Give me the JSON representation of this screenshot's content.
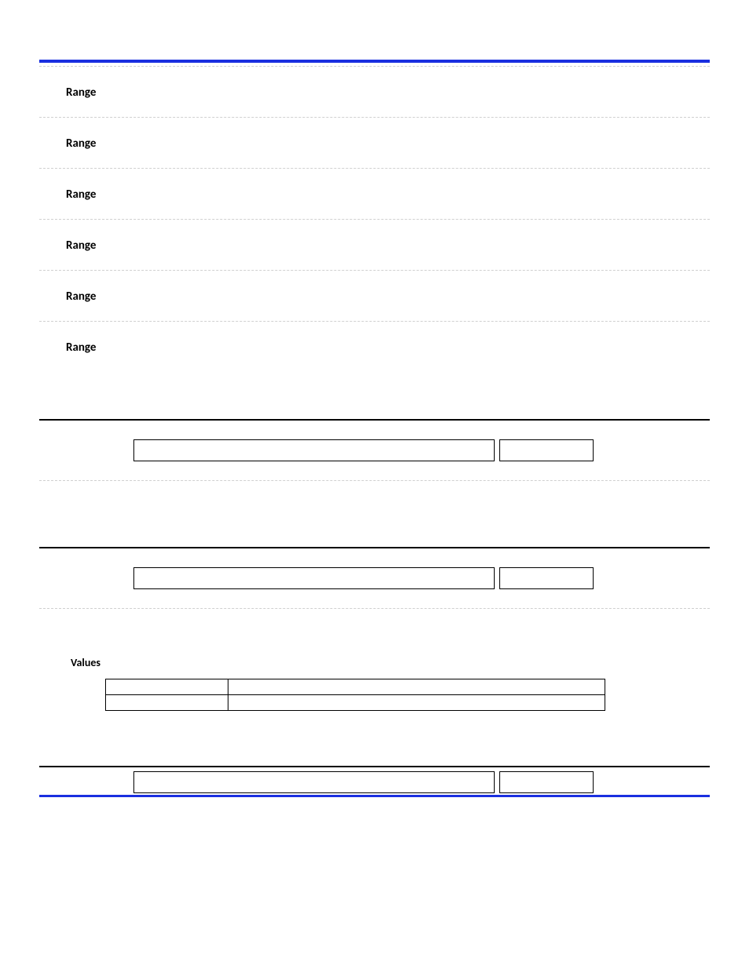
{
  "ranges": [
    {
      "label": "Range"
    },
    {
      "label": "Range"
    },
    {
      "label": "Range"
    },
    {
      "label": "Range"
    },
    {
      "label": "Range"
    },
    {
      "label": "Range"
    }
  ],
  "section1": {
    "box1": "",
    "box2": ""
  },
  "section2": {
    "box1": "",
    "box2": "",
    "values_heading": "Values",
    "table_rows": [
      {
        "c1": "",
        "c2": ""
      },
      {
        "c1": "",
        "c2": ""
      }
    ]
  },
  "section3": {
    "box1": "",
    "box2": ""
  }
}
